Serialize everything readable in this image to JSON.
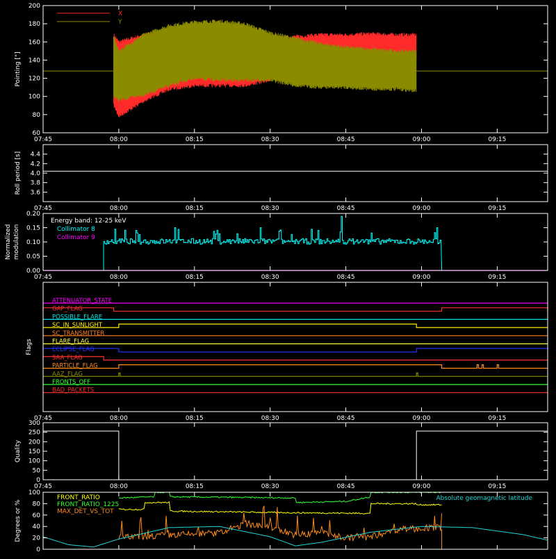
{
  "colors": {
    "background": "#000000",
    "axis": "#ffffff",
    "x_pointing": "#ff2a2a",
    "y_pointing": "#8b8b00",
    "white_trace": "#ffffff",
    "collimator8": "#00ffff",
    "collimator9": "#ff00ff",
    "front_ratio": "#ffff00",
    "front_ratio_1225": "#33ff33",
    "max_det_vs_tot": "#ff8c1a",
    "geomag": "#22d4d4"
  },
  "time_axis": {
    "start": "07:45",
    "end": "09:25",
    "tick_labels": [
      "07:45",
      "08:00",
      "08:15",
      "08:30",
      "08:45",
      "09:00",
      "09:15"
    ]
  },
  "chart_data": [
    {
      "type": "line",
      "id": "pointing",
      "ylabel": "Pointing [\"]",
      "ylim": [
        60,
        200
      ],
      "yticks": [
        "60",
        "80",
        "100",
        "120",
        "140",
        "160",
        "180",
        "200"
      ],
      "legend": [
        "X",
        "Y"
      ],
      "legend_placement": "top-left",
      "baseline_y": 128,
      "data_window": [
        "07:59",
        "08:59"
      ],
      "series": [
        {
          "name": "X",
          "color_key": "x_pointing",
          "time": [
            "07:59",
            "08:00",
            "08:05",
            "08:10",
            "08:15",
            "08:20",
            "08:25",
            "08:30",
            "08:35",
            "08:40",
            "08:45",
            "08:50",
            "08:55",
            "08:59"
          ],
          "upper": [
            168,
            160,
            168,
            172,
            172,
            170,
            168,
            164,
            166,
            168,
            168,
            169,
            168,
            168
          ],
          "lower": [
            90,
            78,
            95,
            108,
            112,
            112,
            112,
            118,
            128,
            136,
            138,
            140,
            142,
            142
          ]
        },
        {
          "name": "Y",
          "color_key": "y_pointing",
          "time": [
            "07:59",
            "08:00",
            "08:05",
            "08:10",
            "08:15",
            "08:20",
            "08:25",
            "08:30",
            "08:35",
            "08:40",
            "08:45",
            "08:50",
            "08:55",
            "08:59"
          ],
          "upper": [
            166,
            150,
            168,
            178,
            182,
            183,
            180,
            170,
            164,
            158,
            154,
            152,
            150,
            150
          ],
          "lower": [
            100,
            96,
            102,
            112,
            120,
            118,
            118,
            118,
            112,
            110,
            110,
            108,
            108,
            106
          ]
        }
      ]
    },
    {
      "type": "line",
      "id": "roll",
      "ylabel": "Roll period [s]",
      "ylim": [
        3.4,
        4.6
      ],
      "yticks": [
        "3.6",
        "3.8",
        "4.0",
        "4.2",
        "4.4"
      ],
      "series": [
        {
          "name": "",
          "color_key": "white_trace",
          "time": [
            "07:45",
            "09:25"
          ],
          "values": [
            4.04,
            4.04
          ]
        }
      ]
    },
    {
      "type": "line",
      "id": "modulation",
      "ylabel": "Normalized modulation",
      "ylim": [
        0.0,
        0.2
      ],
      "yticks": [
        "0.00",
        "0.05",
        "0.10",
        "0.15",
        "0.20"
      ],
      "annotation": "Energy band: 12-25 keV",
      "legend": [
        "Collimator 8",
        "Collimator 9"
      ],
      "legend_placement": "top-left",
      "series": [
        {
          "name": "Collimator 8",
          "color_key": "collimator8",
          "time": [
            "07:57",
            "09:04"
          ],
          "level": 0.1,
          "noise": 0.02,
          "spikes": [
            [
              "08:44",
              0.19
            ],
            [
              "08:11",
              0.15
            ],
            [
              "08:28",
              0.15
            ],
            [
              "09:03",
              0.15
            ]
          ]
        },
        {
          "name": "Collimator 9",
          "color_key": "collimator9",
          "time": [
            "07:45",
            "09:25"
          ],
          "values": [
            0.0,
            0.0
          ]
        }
      ]
    },
    {
      "type": "step",
      "id": "flags",
      "ylabel": "Flags",
      "rows": [
        {
          "name": "ATTENUATOR_STATE",
          "color": "#ff00ff",
          "segments": []
        },
        {
          "name": "GAP_FLAG",
          "color": "#ff3030",
          "segments": [
            [
              "07:45",
              "07:59"
            ],
            [
              "09:04",
              "09:25"
            ]
          ]
        },
        {
          "name": "POSSIBLE_FLARE",
          "color": "#00e0e0",
          "segments": []
        },
        {
          "name": "SC_IN_SUNLIGHT",
          "color": "#ffee00",
          "segments": [
            [
              "08:00",
              "08:59"
            ]
          ]
        },
        {
          "name": "SC_TRANSMITTER",
          "color": "#ff8020",
          "segments": []
        },
        {
          "name": "FLARE_FLAG",
          "color": "#ffff40",
          "segments": []
        },
        {
          "name": "ECLIPSE_FLAG",
          "color": "#2233ff",
          "segments": [
            [
              "07:45",
              "08:00"
            ],
            [
              "08:59",
              "09:25"
            ]
          ]
        },
        {
          "name": "SAA_FLAG",
          "color": "#ff3030",
          "segments": [
            [
              "07:45",
              "07:57"
            ]
          ]
        },
        {
          "name": "PARTICLE_FLAG",
          "color": "#ff8c1a",
          "segments": [
            [
              "08:00",
              "09:04"
            ],
            [
              "09:11",
              "09:11"
            ],
            [
              "09:12",
              "09:12"
            ],
            [
              "09:15",
              "09:15"
            ]
          ]
        },
        {
          "name": "AAZ_FLAG",
          "color": "#8b8b00",
          "segments": [
            [
              "08:00",
              "08:00"
            ],
            [
              "08:59",
              "08:59"
            ]
          ]
        },
        {
          "name": "FRONTS_OFF",
          "color": "#33ff33",
          "segments": []
        },
        {
          "name": "BAD_PACKETS",
          "color": "#ff3030",
          "segments": []
        }
      ]
    },
    {
      "type": "line",
      "id": "quality",
      "ylabel": "Quality",
      "ylim": [
        0,
        300
      ],
      "yticks": [
        "0",
        "50",
        "100",
        "150",
        "200",
        "250",
        "300"
      ],
      "series": [
        {
          "name": "",
          "color_key": "white_trace",
          "time": [
            "07:45",
            "08:00",
            "08:00",
            "08:59",
            "08:59",
            "09:25"
          ],
          "values": [
            256,
            256,
            0,
            0,
            256,
            256
          ]
        }
      ]
    },
    {
      "type": "line",
      "id": "ratios",
      "ylabel": "Degrees or %",
      "ylim": [
        0,
        100
      ],
      "yticks": [
        "0",
        "20",
        "40",
        "60",
        "80",
        "100"
      ],
      "legend": [
        "FRONT_RATIO",
        "FRONT_RATIO_1225",
        "MAX_DET_VS_TOT"
      ],
      "legend_placement": "top-left",
      "right_legend": "Absolute geomagnetic latitude",
      "series": [
        {
          "name": "FRONT_RATIO",
          "color_key": "front_ratio",
          "time": [
            "08:00",
            "08:05",
            "08:05",
            "08:10",
            "08:10",
            "08:35",
            "08:35",
            "08:50",
            "08:50",
            "08:59",
            "08:59",
            "09:04"
          ],
          "values": [
            70,
            70,
            82,
            82,
            67,
            64,
            64,
            63,
            80,
            80,
            78,
            78
          ]
        },
        {
          "name": "FRONT_RATIO_1225",
          "color_key": "front_ratio_1225",
          "time": [
            "08:00",
            "08:07",
            "08:07",
            "08:10",
            "08:10",
            "08:35",
            "08:35",
            "08:45",
            "08:50",
            "08:50",
            "09:04"
          ],
          "values": [
            90,
            92,
            100,
            100,
            92,
            90,
            82,
            84,
            92,
            100,
            100
          ]
        },
        {
          "name": "MAX_DET_VS_TOT",
          "color_key": "max_det_vs_tot",
          "time": [
            "08:00",
            "08:10",
            "08:20",
            "08:25",
            "08:30",
            "08:35",
            "08:40",
            "08:45",
            "08:50",
            "08:55",
            "09:04"
          ],
          "values": [
            20,
            25,
            28,
            45,
            40,
            25,
            30,
            20,
            22,
            35,
            38
          ]
        },
        {
          "name": "Absolute geomagnetic latitude",
          "color_key": "geomag",
          "time": [
            "07:45",
            "07:50",
            "07:55",
            "08:00",
            "08:10",
            "08:20",
            "08:30",
            "08:35",
            "08:40",
            "08:50",
            "09:00",
            "09:10",
            "09:20",
            "09:25"
          ],
          "values": [
            22,
            8,
            4,
            18,
            38,
            40,
            22,
            6,
            12,
            30,
            40,
            38,
            26,
            16
          ]
        }
      ]
    }
  ]
}
